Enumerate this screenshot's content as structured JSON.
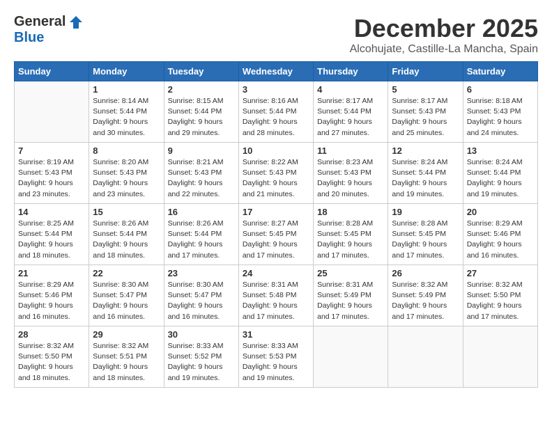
{
  "header": {
    "logo_general": "General",
    "logo_blue": "Blue",
    "month_title": "December 2025",
    "location": "Alcohujate, Castille-La Mancha, Spain"
  },
  "days_of_week": [
    "Sunday",
    "Monday",
    "Tuesday",
    "Wednesday",
    "Thursday",
    "Friday",
    "Saturday"
  ],
  "weeks": [
    [
      {
        "day": "",
        "sunrise": "",
        "sunset": "",
        "daylight": ""
      },
      {
        "day": "1",
        "sunrise": "Sunrise: 8:14 AM",
        "sunset": "Sunset: 5:44 PM",
        "daylight": "Daylight: 9 hours and 30 minutes."
      },
      {
        "day": "2",
        "sunrise": "Sunrise: 8:15 AM",
        "sunset": "Sunset: 5:44 PM",
        "daylight": "Daylight: 9 hours and 29 minutes."
      },
      {
        "day": "3",
        "sunrise": "Sunrise: 8:16 AM",
        "sunset": "Sunset: 5:44 PM",
        "daylight": "Daylight: 9 hours and 28 minutes."
      },
      {
        "day": "4",
        "sunrise": "Sunrise: 8:17 AM",
        "sunset": "Sunset: 5:44 PM",
        "daylight": "Daylight: 9 hours and 27 minutes."
      },
      {
        "day": "5",
        "sunrise": "Sunrise: 8:17 AM",
        "sunset": "Sunset: 5:43 PM",
        "daylight": "Daylight: 9 hours and 25 minutes."
      },
      {
        "day": "6",
        "sunrise": "Sunrise: 8:18 AM",
        "sunset": "Sunset: 5:43 PM",
        "daylight": "Daylight: 9 hours and 24 minutes."
      }
    ],
    [
      {
        "day": "7",
        "sunrise": "Sunrise: 8:19 AM",
        "sunset": "Sunset: 5:43 PM",
        "daylight": "Daylight: 9 hours and 23 minutes."
      },
      {
        "day": "8",
        "sunrise": "Sunrise: 8:20 AM",
        "sunset": "Sunset: 5:43 PM",
        "daylight": "Daylight: 9 hours and 23 minutes."
      },
      {
        "day": "9",
        "sunrise": "Sunrise: 8:21 AM",
        "sunset": "Sunset: 5:43 PM",
        "daylight": "Daylight: 9 hours and 22 minutes."
      },
      {
        "day": "10",
        "sunrise": "Sunrise: 8:22 AM",
        "sunset": "Sunset: 5:43 PM",
        "daylight": "Daylight: 9 hours and 21 minutes."
      },
      {
        "day": "11",
        "sunrise": "Sunrise: 8:23 AM",
        "sunset": "Sunset: 5:43 PM",
        "daylight": "Daylight: 9 hours and 20 minutes."
      },
      {
        "day": "12",
        "sunrise": "Sunrise: 8:24 AM",
        "sunset": "Sunset: 5:44 PM",
        "daylight": "Daylight: 9 hours and 19 minutes."
      },
      {
        "day": "13",
        "sunrise": "Sunrise: 8:24 AM",
        "sunset": "Sunset: 5:44 PM",
        "daylight": "Daylight: 9 hours and 19 minutes."
      }
    ],
    [
      {
        "day": "14",
        "sunrise": "Sunrise: 8:25 AM",
        "sunset": "Sunset: 5:44 PM",
        "daylight": "Daylight: 9 hours and 18 minutes."
      },
      {
        "day": "15",
        "sunrise": "Sunrise: 8:26 AM",
        "sunset": "Sunset: 5:44 PM",
        "daylight": "Daylight: 9 hours and 18 minutes."
      },
      {
        "day": "16",
        "sunrise": "Sunrise: 8:26 AM",
        "sunset": "Sunset: 5:44 PM",
        "daylight": "Daylight: 9 hours and 17 minutes."
      },
      {
        "day": "17",
        "sunrise": "Sunrise: 8:27 AM",
        "sunset": "Sunset: 5:45 PM",
        "daylight": "Daylight: 9 hours and 17 minutes."
      },
      {
        "day": "18",
        "sunrise": "Sunrise: 8:28 AM",
        "sunset": "Sunset: 5:45 PM",
        "daylight": "Daylight: 9 hours and 17 minutes."
      },
      {
        "day": "19",
        "sunrise": "Sunrise: 8:28 AM",
        "sunset": "Sunset: 5:45 PM",
        "daylight": "Daylight: 9 hours and 17 minutes."
      },
      {
        "day": "20",
        "sunrise": "Sunrise: 8:29 AM",
        "sunset": "Sunset: 5:46 PM",
        "daylight": "Daylight: 9 hours and 16 minutes."
      }
    ],
    [
      {
        "day": "21",
        "sunrise": "Sunrise: 8:29 AM",
        "sunset": "Sunset: 5:46 PM",
        "daylight": "Daylight: 9 hours and 16 minutes."
      },
      {
        "day": "22",
        "sunrise": "Sunrise: 8:30 AM",
        "sunset": "Sunset: 5:47 PM",
        "daylight": "Daylight: 9 hours and 16 minutes."
      },
      {
        "day": "23",
        "sunrise": "Sunrise: 8:30 AM",
        "sunset": "Sunset: 5:47 PM",
        "daylight": "Daylight: 9 hours and 16 minutes."
      },
      {
        "day": "24",
        "sunrise": "Sunrise: 8:31 AM",
        "sunset": "Sunset: 5:48 PM",
        "daylight": "Daylight: 9 hours and 17 minutes."
      },
      {
        "day": "25",
        "sunrise": "Sunrise: 8:31 AM",
        "sunset": "Sunset: 5:49 PM",
        "daylight": "Daylight: 9 hours and 17 minutes."
      },
      {
        "day": "26",
        "sunrise": "Sunrise: 8:32 AM",
        "sunset": "Sunset: 5:49 PM",
        "daylight": "Daylight: 9 hours and 17 minutes."
      },
      {
        "day": "27",
        "sunrise": "Sunrise: 8:32 AM",
        "sunset": "Sunset: 5:50 PM",
        "daylight": "Daylight: 9 hours and 17 minutes."
      }
    ],
    [
      {
        "day": "28",
        "sunrise": "Sunrise: 8:32 AM",
        "sunset": "Sunset: 5:50 PM",
        "daylight": "Daylight: 9 hours and 18 minutes."
      },
      {
        "day": "29",
        "sunrise": "Sunrise: 8:32 AM",
        "sunset": "Sunset: 5:51 PM",
        "daylight": "Daylight: 9 hours and 18 minutes."
      },
      {
        "day": "30",
        "sunrise": "Sunrise: 8:33 AM",
        "sunset": "Sunset: 5:52 PM",
        "daylight": "Daylight: 9 hours and 19 minutes."
      },
      {
        "day": "31",
        "sunrise": "Sunrise: 8:33 AM",
        "sunset": "Sunset: 5:53 PM",
        "daylight": "Daylight: 9 hours and 19 minutes."
      },
      {
        "day": "",
        "sunrise": "",
        "sunset": "",
        "daylight": ""
      },
      {
        "day": "",
        "sunrise": "",
        "sunset": "",
        "daylight": ""
      },
      {
        "day": "",
        "sunrise": "",
        "sunset": "",
        "daylight": ""
      }
    ]
  ]
}
